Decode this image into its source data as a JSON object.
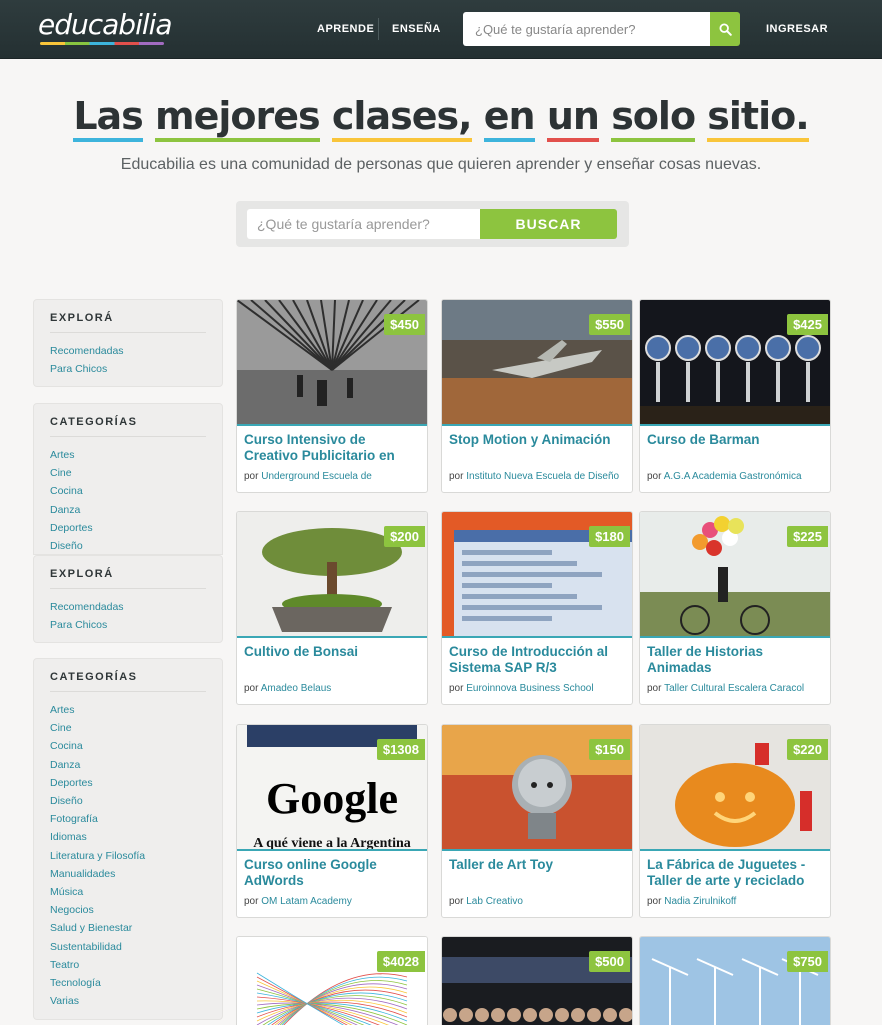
{
  "header": {
    "logo": "educabilia",
    "nav": [
      "APRENDE",
      "ENSEÑA"
    ],
    "search_placeholder": "¿Qué te gustaría aprender?",
    "login": "INGRESAR"
  },
  "hero": {
    "title_words": [
      "Las",
      "mejores",
      "clases,",
      "en",
      "un",
      "solo",
      "sitio."
    ],
    "underline_colors": [
      "#3db4dc",
      "#8dc43f",
      "#f9c53a",
      "#3db4dc",
      "#e2504c",
      "#8dc43f",
      "#f9c53a"
    ],
    "subtitle": "Educabilia es una comunidad de personas que quieren aprender y enseñar cosas nuevas.",
    "search_placeholder": "¿Qué te gustaría aprender?",
    "search_button": "BUSCAR"
  },
  "sidebar": {
    "box1": {
      "heading": "EXPLORÁ",
      "items": [
        "Recomendadas",
        "Para Chicos"
      ]
    },
    "box2": {
      "heading": "CATEGORÍAS",
      "items": [
        "Artes",
        "Cine",
        "Cocina",
        "Danza",
        "Deportes",
        "Diseño"
      ]
    },
    "box3": {
      "heading": "EXPLORÁ",
      "items": [
        "Recomendadas",
        "Para Chicos"
      ]
    },
    "box4": {
      "heading": "CATEGORÍAS",
      "items": [
        "Artes",
        "Cine",
        "Cocina",
        "Danza",
        "Deportes",
        "Diseño",
        "Fotografía",
        "Idiomas",
        "Literatura y Filosofía",
        "Manualidades",
        "Música",
        "Negocios",
        "Salud y Bienestar",
        "Sustentabilidad",
        "Teatro",
        "Tecnología",
        "Varias"
      ]
    }
  },
  "by_label": "por",
  "courses": [
    {
      "price": "$450",
      "title": "Curso Intensivo de Creativo Publicitario en",
      "author": "Underground Escuela de",
      "image": "bridge-photo"
    },
    {
      "price": "$550",
      "title": "Stop Motion y Animación",
      "author": "Instituto Nueva Escuela de Diseño",
      "image": "model-plane-photo"
    },
    {
      "price": "$425",
      "title": "Curso de Barman",
      "author": "A.G.A Academia Gastronómica",
      "image": "beer-taps-photo"
    },
    {
      "price": "$200",
      "title": "Cultivo de Bonsai",
      "author": "Amadeo Belaus",
      "image": "bonsai-photo"
    },
    {
      "price": "$180",
      "title": "Curso de Introducción al Sistema SAP R/3",
      "author": "Euroinnova Business School",
      "image": "sap-screen-photo"
    },
    {
      "price": "$225",
      "title": "Taller de Historias Animadas",
      "author": "Taller Cultural Escalera Caracol",
      "image": "balloons-bike-photo"
    },
    {
      "price": "$1308",
      "title": "Curso online Google AdWords",
      "author": "OM Latam Academy",
      "image": "google-newspaper-photo",
      "image_text_logo": "Google",
      "image_text_caption": "A qué viene a la Argentina"
    },
    {
      "price": "$150",
      "title": "Taller de Art Toy",
      "author": "Lab Creativo",
      "image": "art-toy-photo"
    },
    {
      "price": "$220",
      "title": "La Fábrica de Juguetes - Taller de arte y reciclado",
      "author": "Nadia Zirulnikoff",
      "image": "pumpkin-lego-photo"
    },
    {
      "price": "$4028",
      "title": "",
      "author": "",
      "image": "network-graph-photo"
    },
    {
      "price": "$500",
      "title": "",
      "author": "",
      "image": "audience-photo"
    },
    {
      "price": "$750",
      "title": "",
      "author": "",
      "image": "wind-turbines-photo"
    }
  ],
  "colors": {
    "accent_green": "#8dc43f",
    "link_teal": "#2a8a9c",
    "header_bg": "#2b3739"
  }
}
